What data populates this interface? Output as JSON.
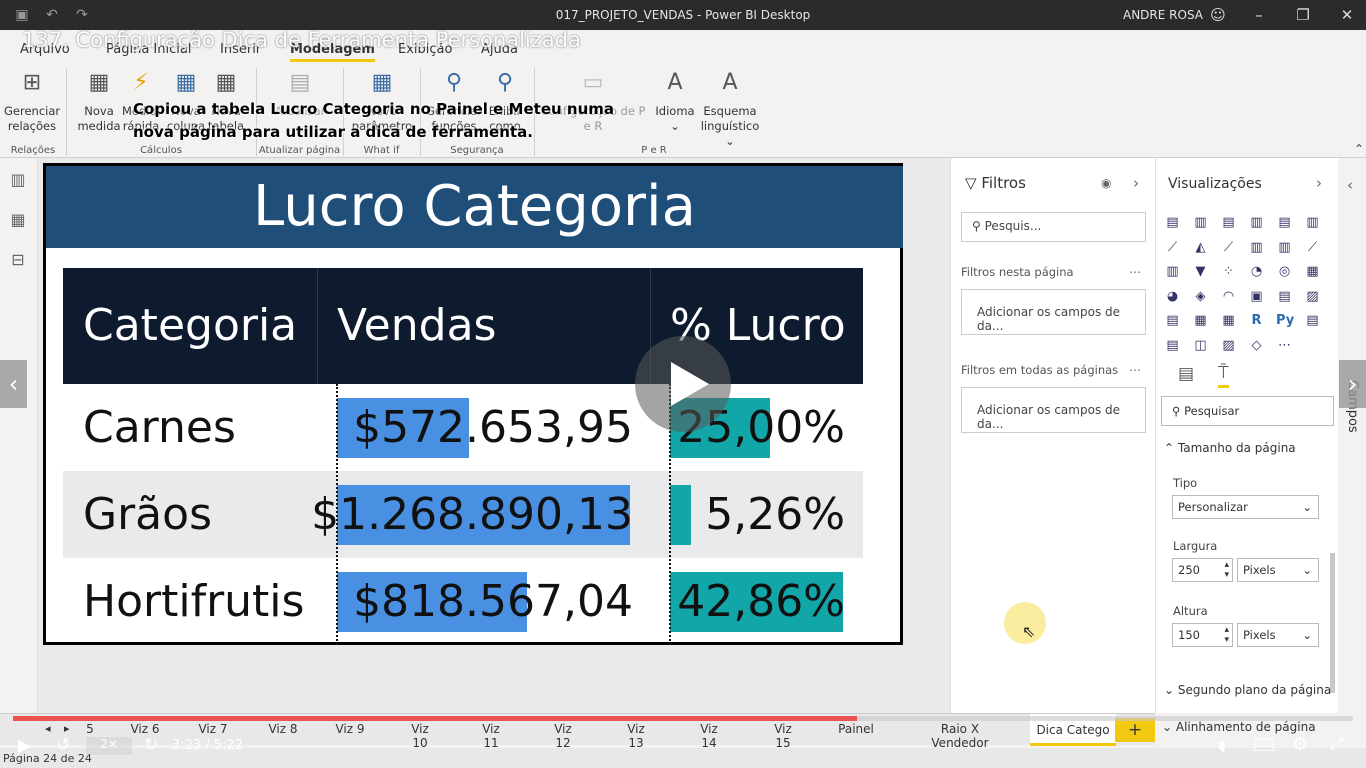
{
  "titlebar": {
    "title": "017_PROJETO_VENDAS - Power BI Desktop",
    "user": "ANDRE ROSA"
  },
  "course_overlay": "137. Configuração Dica de Ferramenta Personalizada",
  "menu": [
    "Arquivo",
    "Página Inicial",
    "Inserir",
    "Modelagem",
    "Exibição",
    "Ajuda"
  ],
  "ribbon": {
    "gerenciar_relacoes": "Gerenciar relações",
    "nova_medida": "Nova medida",
    "medida_rapida": "Medida rápida",
    "nova_coluna": "Nova coluna",
    "nova_tabela": "Nova tabela",
    "atualizar": "Atualizar",
    "novo_parametro": "Novo parâmetro",
    "gerenciar_funcoes": "Gerenciar funções",
    "exibir_como": "Exibir como",
    "configuracao_pe_r": "Configuração de P e R",
    "idioma": "Idioma",
    "esquema": "Esquema linguístico",
    "groups": {
      "relacoes": "Relações",
      "calculos": "Cálculos",
      "atualizar": "Atualizar página",
      "whatif": "What if",
      "seguranca": "Segurança",
      "per": "P e R"
    }
  },
  "note": "Copiou a tabela Lucro Categoria no Painel e Meteu numa nova página para utilizar a dica de ferramenta.",
  "report": {
    "title": "Lucro Categoria",
    "headers": [
      "Categoria",
      "Vendas",
      "% Lucro"
    ],
    "rows": [
      {
        "categoria": "Carnes",
        "vendas": "$572.653,95",
        "lucro": "25,00%",
        "vendas_frac": 0.45,
        "lucro_frac": 0.58
      },
      {
        "categoria": "Grãos",
        "vendas": "$1.268.890,13",
        "lucro": "5,26%",
        "vendas_frac": 1.0,
        "lucro_frac": 0.12
      },
      {
        "categoria": "Hortifrutis",
        "vendas": "$818.567,04",
        "lucro": "42,86%",
        "vendas_frac": 0.65,
        "lucro_frac": 1.0
      }
    ]
  },
  "filters": {
    "header": "Filtros",
    "search_placeholder": "Pesquis...",
    "this_page": "Filtros nesta página",
    "all_pages": "Filtros em todas as páginas",
    "add_fields": "Adicionar os campos de da..."
  },
  "viz": {
    "header": "Visualizações",
    "search_placeholder": "Pesquisar",
    "page_size": "Tamanho da página",
    "tipo_label": "Tipo",
    "tipo_value": "Personalizar",
    "largura_label": "Largura",
    "largura_value": "250",
    "altura_label": "Altura",
    "altura_value": "150",
    "unit": "Pixels",
    "segundo_plano": "Segundo plano da página",
    "alinhamento": "Alinhamento de página"
  },
  "campos": "Campos",
  "tabs": [
    "5",
    "Viz 6",
    "Viz 7",
    "Viz 8",
    "Viz 9",
    "Viz 10",
    "Viz 11",
    "Viz 12",
    "Viz 13",
    "Viz 14",
    "Viz 15",
    "Painel",
    "Raio X Vendedor",
    "Dica Catego"
  ],
  "status": "Página 24 de 24",
  "video": {
    "speed": "2×",
    "time": "3:23 / 5:22",
    "progress": 0.63
  },
  "colors": {
    "banner": "#1f4e79",
    "header_bg": "#0e1b2e",
    "vendas_bar": "#4a90e2",
    "lucro_bar": "#13a6a8",
    "accent": "#f2c811"
  }
}
